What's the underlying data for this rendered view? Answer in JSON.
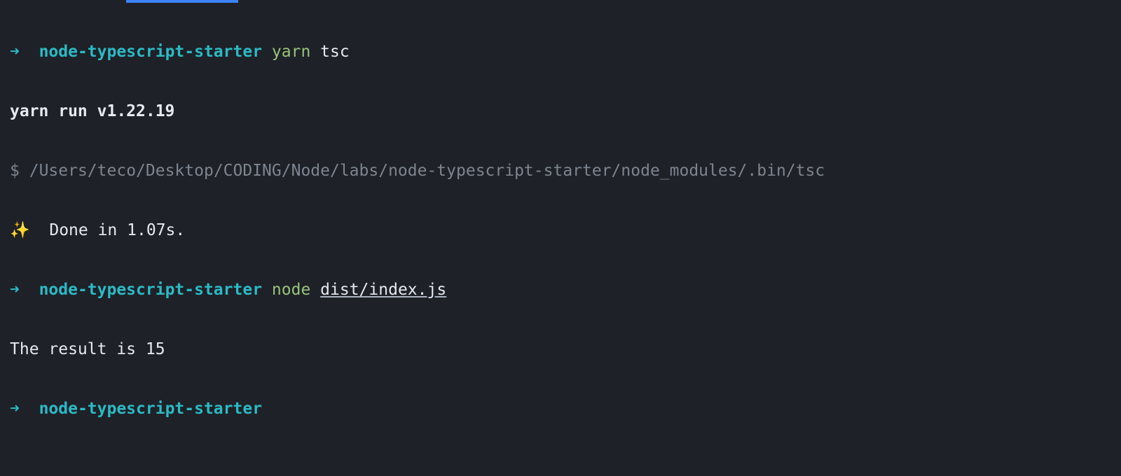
{
  "prompt": {
    "arrow": "➜",
    "dir": "node-typescript-starter"
  },
  "lines": {
    "cmd1_yarn": "yarn",
    "cmd1_tsc": "tsc",
    "yarn_run": "yarn run v1.22.19",
    "dollar": "$",
    "path": "/Users/teco/Desktop/CODING/Node/labs/node-typescript-starter/node_modules/.bin/tsc",
    "sparkle": "✨",
    "done": "Done in 1.07s.",
    "cmd2_node": "node",
    "cmd2_arg": "dist/index.js",
    "result": "The result is 15"
  }
}
